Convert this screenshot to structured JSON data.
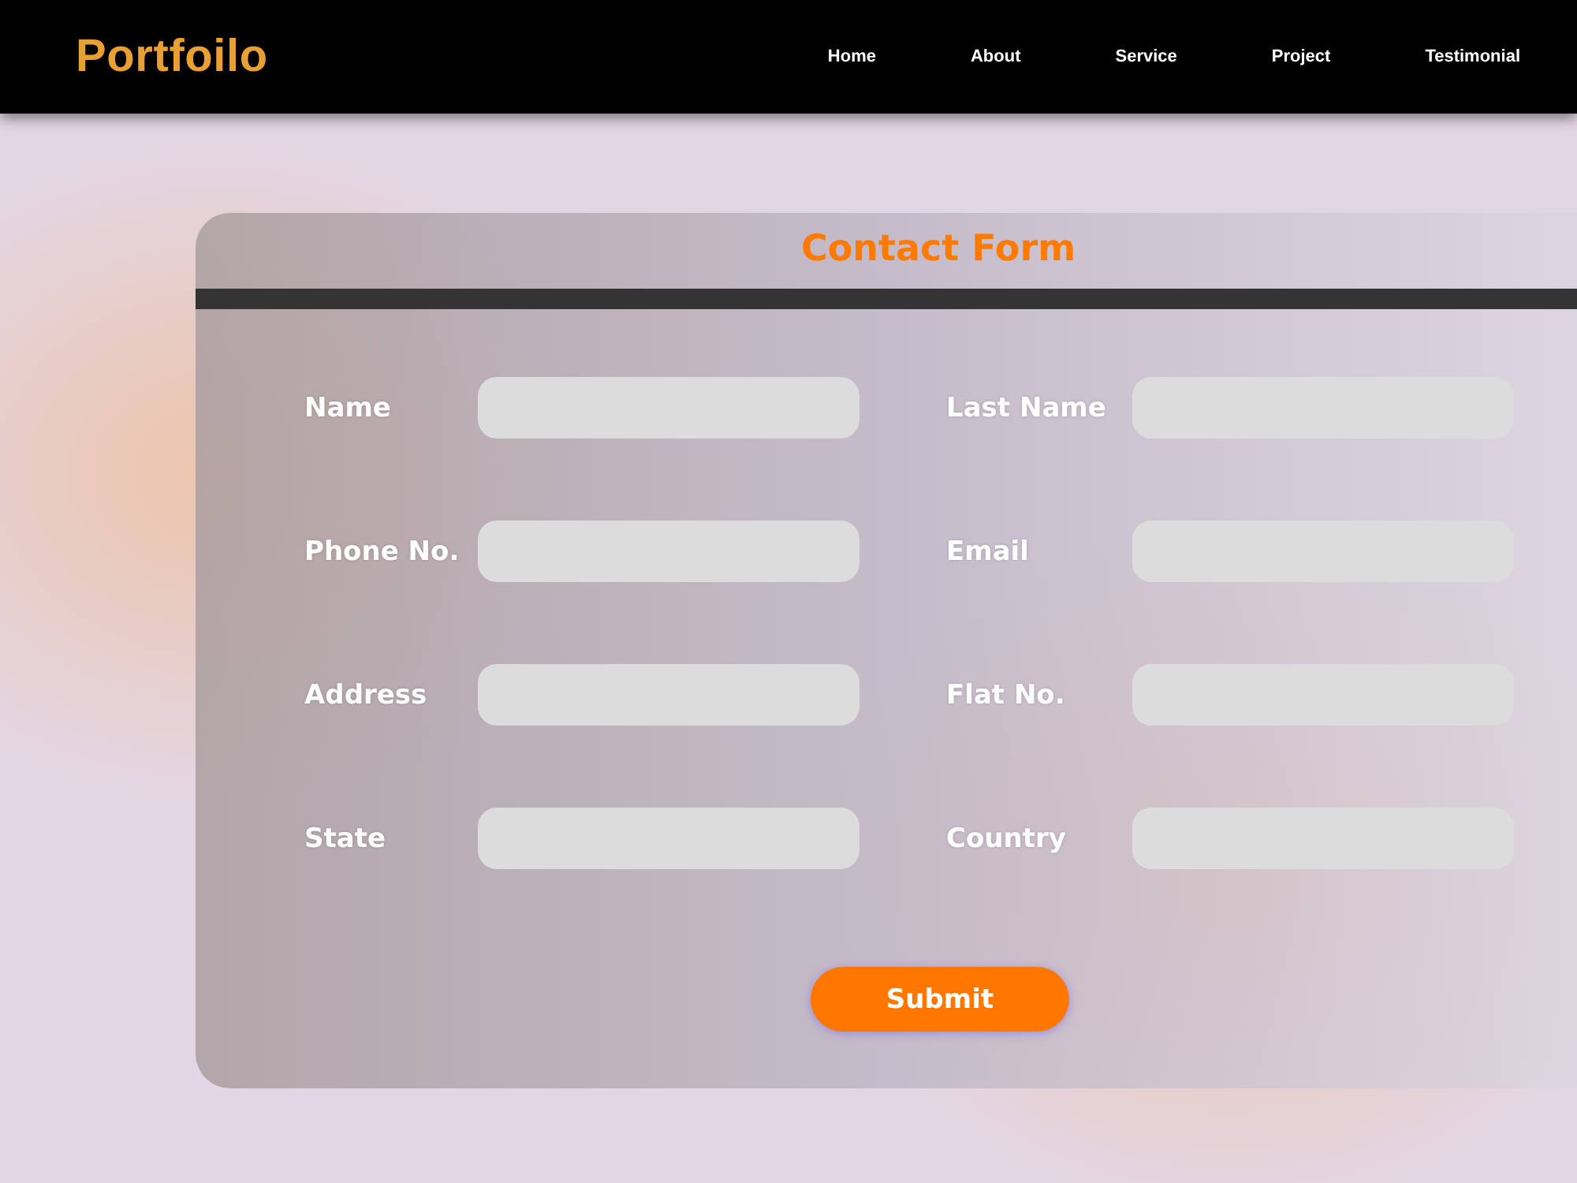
{
  "nav": {
    "logo": "Portfoilo",
    "links": [
      "Home",
      "About",
      "Service",
      "Project",
      "Testimonial"
    ]
  },
  "form": {
    "title": "Contact Form",
    "fields": [
      {
        "label": "Name"
      },
      {
        "label": "Last Name"
      },
      {
        "label": "Phone No."
      },
      {
        "label": "Email"
      },
      {
        "label": "Address"
      },
      {
        "label": "Flat No."
      },
      {
        "label": "State"
      },
      {
        "label": "Country"
      }
    ],
    "submit": "Submit"
  }
}
